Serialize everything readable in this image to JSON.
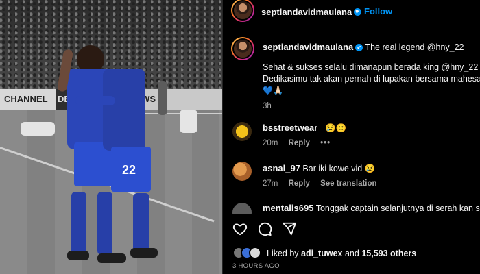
{
  "post": {
    "image_alt": "Two football players in blue kits embracing on the pitch",
    "board_texts": [
      "CHANNEL",
      "DE",
      "OWS"
    ],
    "shirt_numbers": [
      "22"
    ]
  },
  "header": {
    "username": "septiandavidmaulana",
    "verified": "✔",
    "separator": "•",
    "follow_label": "Follow"
  },
  "caption": {
    "username": "septiandavidmaulana",
    "text_line1": "The real legend @hny_22",
    "text_line2": "Sehat & sukses selalu dimanapun berada king @hny_22",
    "text_line3": "Dedikasimu tak akan pernah di lupakan bersama mahesa jenar",
    "emojis": "💙🙏🏻",
    "time": "3h"
  },
  "comments": [
    {
      "username": "bsstreetwear_",
      "text": "😢🙁",
      "time": "20m",
      "reply_label": "Reply",
      "more_label": "•••",
      "avatar_color": "#d9a21b"
    },
    {
      "username": "asnal_97",
      "text": "Bar iki kowe vid 😢",
      "time": "27m",
      "reply_label": "Reply",
      "translate_label": "See translation",
      "avatar_color": "#c8783b"
    },
    {
      "username": "mentalis695",
      "text": "Tonggak captain selanjutnya di serah kan sdr",
      "avatar_color": "#6b6b6b"
    }
  ],
  "actions": {
    "like_icon": "heart-icon",
    "comment_icon": "comment-icon",
    "share_icon": "share-icon",
    "liked_prefix": "Liked by",
    "liked_user": "adi_tuwex",
    "liked_and": "and",
    "liked_count": "15,593 others",
    "time_ago": "3 HOURS AGO"
  },
  "colors": {
    "accent": "#0095f6",
    "text": "#f5f5f5",
    "muted": "#a8a8a8",
    "kit_blue": "#2b46b8"
  }
}
